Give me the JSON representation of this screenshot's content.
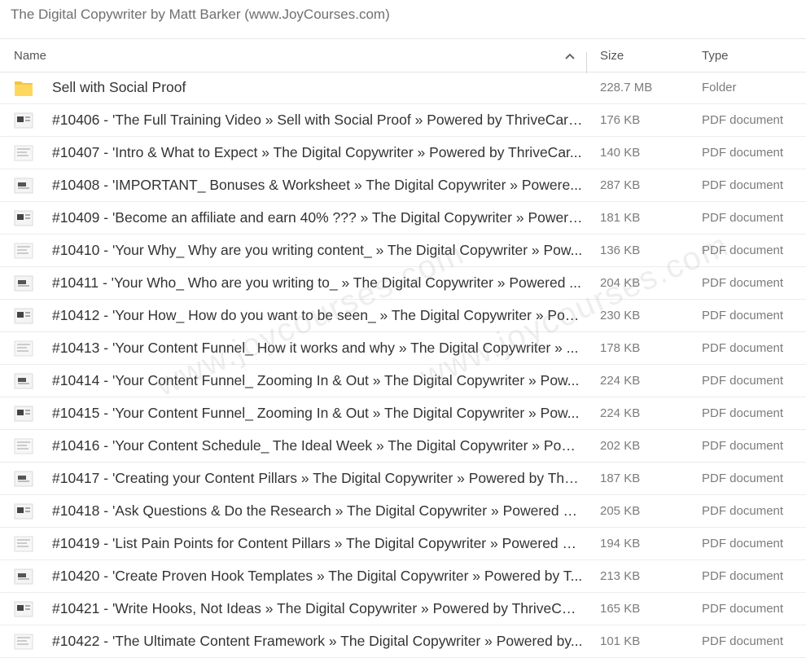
{
  "window": {
    "title": "The Digital Copywriter by Matt Barker (www.JoyCourses.com)"
  },
  "columns": {
    "name": "Name",
    "size": "Size",
    "type": "Type",
    "sort_icon": "chevron-up-icon"
  },
  "watermark": "www.joycourses.com",
  "colors": {
    "folder": "#f5c542",
    "row_border": "#ececec",
    "text_secondary": "#7b7b7b"
  },
  "rows": [
    {
      "name": "Sell with Social Proof",
      "size": "228.7 MB",
      "type": "Folder",
      "icon": "folder-icon"
    },
    {
      "name": "#10406 - 'The Full Training Video » Sell with Social Proof » Powered by ThriveCart' ...",
      "size": "176 KB",
      "type": "PDF document",
      "icon": "pdf-thumbnail-icon"
    },
    {
      "name": "#10407 - 'Intro & What to Expect » The Digital Copywriter » Powered by ThriveCar...",
      "size": "140 KB",
      "type": "PDF document",
      "icon": "pdf-thumbnail-icon"
    },
    {
      "name": "#10408 - 'IMPORTANT_ Bonuses & Worksheet » The Digital Copywriter » Powere...",
      "size": "287 KB",
      "type": "PDF document",
      "icon": "pdf-thumbnail-icon"
    },
    {
      "name": "#10409 - 'Become an affiliate and earn 40% ??? » The Digital Copywriter » Powere...",
      "size": "181 KB",
      "type": "PDF document",
      "icon": "pdf-thumbnail-icon"
    },
    {
      "name": "#10410 - 'Your Why_ Why are you writing content_ » The Digital Copywriter » Pow...",
      "size": "136 KB",
      "type": "PDF document",
      "icon": "pdf-thumbnail-icon"
    },
    {
      "name": "#10411 - 'Your Who_ Who are you writing to_ » The Digital Copywriter » Powered ...",
      "size": "204 KB",
      "type": "PDF document",
      "icon": "pdf-thumbnail-icon"
    },
    {
      "name": "#10412 - 'Your How_ How do you want to be seen_ » The Digital Copywriter » Pow...",
      "size": "230 KB",
      "type": "PDF document",
      "icon": "pdf-thumbnail-icon"
    },
    {
      "name": "#10413 - 'Your Content Funnel_ How it works and why » The Digital Copywriter » ...",
      "size": "178 KB",
      "type": "PDF document",
      "icon": "pdf-thumbnail-icon"
    },
    {
      "name": "#10414 - 'Your Content Funnel_ Zooming In & Out » The Digital Copywriter » Pow...",
      "size": "224 KB",
      "type": "PDF document",
      "icon": "pdf-thumbnail-icon"
    },
    {
      "name": "#10415 - 'Your Content Funnel_ Zooming In & Out » The Digital Copywriter » Pow...",
      "size": "224 KB",
      "type": "PDF document",
      "icon": "pdf-thumbnail-icon"
    },
    {
      "name": "#10416 - 'Your Content Schedule_ The Ideal Week » The Digital Copywriter » Powe...",
      "size": "202 KB",
      "type": "PDF document",
      "icon": "pdf-thumbnail-icon"
    },
    {
      "name": "#10417 - 'Creating your Content Pillars » The Digital Copywriter » Powered by Thri...",
      "size": "187 KB",
      "type": "PDF document",
      "icon": "pdf-thumbnail-icon"
    },
    {
      "name": "#10418 - 'Ask Questions & Do the Research » The Digital Copywriter » Powered by...",
      "size": "205 KB",
      "type": "PDF document",
      "icon": "pdf-thumbnail-icon"
    },
    {
      "name": "#10419 - 'List Pain Points for Content Pillars » The Digital Copywriter » Powered by...",
      "size": "194 KB",
      "type": "PDF document",
      "icon": "pdf-thumbnail-icon"
    },
    {
      "name": "#10420 - 'Create Proven Hook Templates » The Digital Copywriter » Powered by T...",
      "size": "213 KB",
      "type": "PDF document",
      "icon": "pdf-thumbnail-icon"
    },
    {
      "name": "#10421 - 'Write Hooks, Not Ideas » The Digital Copywriter » Powered by ThriveCar...",
      "size": "165 KB",
      "type": "PDF document",
      "icon": "pdf-thumbnail-icon"
    },
    {
      "name": "#10422 - 'The Ultimate Content Framework » The Digital Copywriter » Powered by...",
      "size": "101 KB",
      "type": "PDF document",
      "icon": "pdf-thumbnail-icon"
    }
  ]
}
